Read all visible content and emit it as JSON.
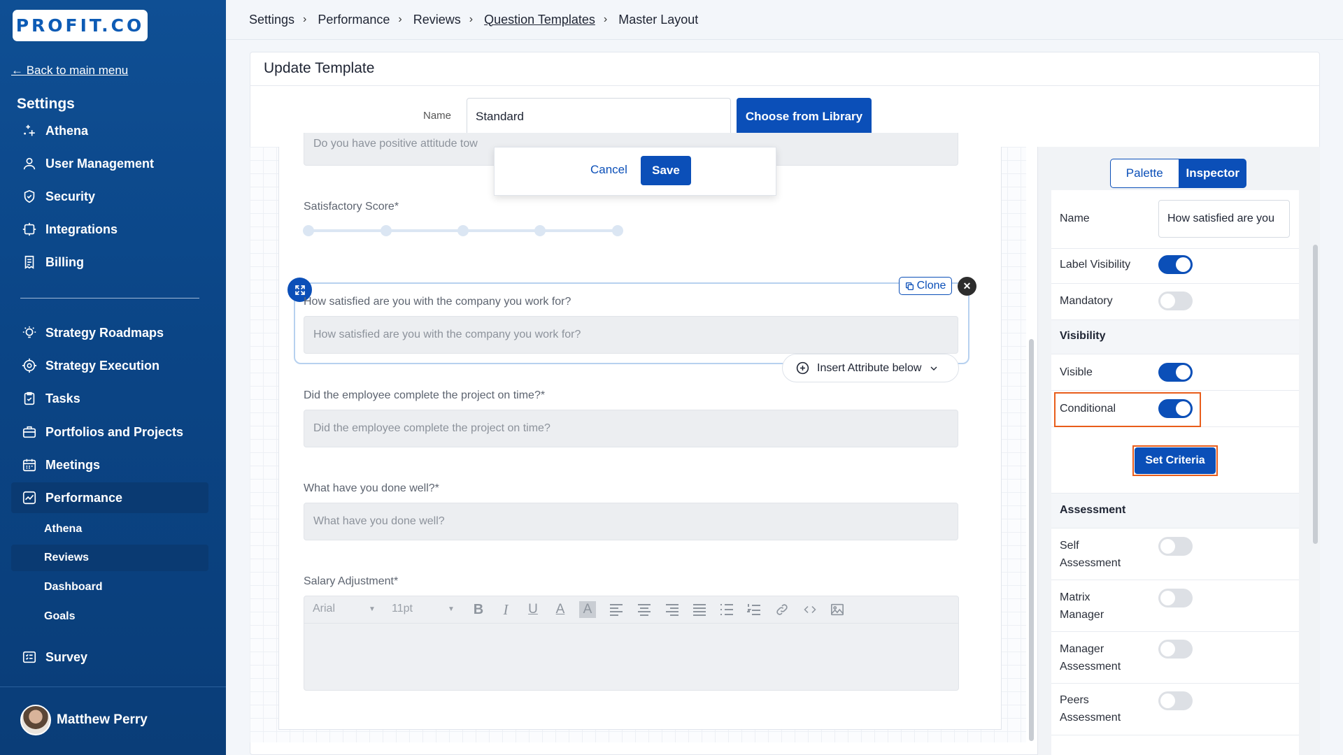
{
  "brand": {
    "logo_text": "PROFIT.CO"
  },
  "sidebar": {
    "back_link": "← Back to main menu",
    "title": "Settings",
    "items": [
      {
        "label": "Athena",
        "icon": "sparkle-icon"
      },
      {
        "label": "User Management",
        "icon": "user-icon"
      },
      {
        "label": "Security",
        "icon": "shield-icon"
      },
      {
        "label": "Integrations",
        "icon": "puzzle-icon"
      },
      {
        "label": "Billing",
        "icon": "receipt-icon"
      },
      {
        "label": "Strategy Roadmaps",
        "icon": "bulb-icon"
      },
      {
        "label": "Strategy Execution",
        "icon": "target-icon"
      },
      {
        "label": "Tasks",
        "icon": "clipboard-check-icon"
      },
      {
        "label": "Portfolios and Projects",
        "icon": "briefcase-icon"
      },
      {
        "label": "Meetings",
        "icon": "calendar-icon"
      },
      {
        "label": "Performance",
        "icon": "chart-line-icon"
      },
      {
        "label": "Survey",
        "icon": "survey-list-icon"
      }
    ],
    "performance_sub": [
      "Athena",
      "Reviews",
      "Dashboard",
      "Goals"
    ],
    "user": {
      "name": "Matthew Perry"
    }
  },
  "breadcrumb": [
    "Settings",
    "Performance",
    "Reviews",
    "Question Templates",
    "Master Layout"
  ],
  "card": {
    "title": "Update Template",
    "name_label": "Name",
    "name_value": "Standard",
    "choose_library": "Choose from Library"
  },
  "popover": {
    "cancel": "Cancel",
    "save": "Save"
  },
  "form": {
    "partial_placeholder": "Do you have positive attitude tow",
    "satisfactory_label": "Satisfactory Score*",
    "slider_points": 5,
    "selected_label": "How satisfied are you with the company you work for?",
    "selected_placeholder": "How satisfied are you with the company you work for?",
    "clone": "Clone",
    "insert_attribute": "Insert Attribute below",
    "q2_label": "Did the employee complete the project on time?*",
    "q2_placeholder": "Did the employee complete the project on time?",
    "q3_label": "What have you done well?*",
    "q3_placeholder": "What have you done well?",
    "q4_label": "Salary Adjustment*",
    "editor_font": "Arial",
    "editor_size": "11pt"
  },
  "panel": {
    "tabs": [
      "Palette",
      "Inspector"
    ],
    "active_tab": "Inspector",
    "name_label": "Name",
    "name_value": "How satisfied are you",
    "label_visibility": "Label Visibility",
    "label_visibility_on": true,
    "mandatory": "Mandatory",
    "mandatory_on": false,
    "visibility_section": "Visibility",
    "visible": "Visible",
    "visible_on": true,
    "conditional": "Conditional",
    "conditional_on": true,
    "set_criteria": "Set Criteria",
    "assessment_section": "Assessment",
    "self_assessment": "Self Assessment",
    "self_assessment_on": false,
    "matrix_manager": "Matrix Manager",
    "matrix_manager_on": false,
    "manager_assessment": "Manager Assessment",
    "manager_assessment_on": false,
    "peers_assessment": "Peers Assessment",
    "peers_assessment_on": false
  },
  "colors": {
    "primary": "#0b4fb8",
    "sidebar": "#0b4586",
    "highlight": "#e85d1b"
  }
}
